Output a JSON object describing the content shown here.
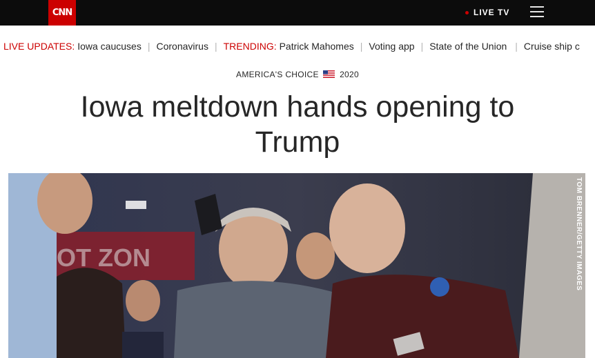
{
  "header": {
    "logo_text": "CNN",
    "live_tv": "LIVE TV",
    "menu_icon": "hamburger-menu-icon",
    "brand_color": "#cc0000"
  },
  "ticker": {
    "items": [
      {
        "prefix": "LIVE UPDATES:",
        "label": "Iowa caucuses"
      },
      {
        "prefix": "",
        "label": "Coronavirus"
      },
      {
        "prefix": "TRENDING:",
        "label": "Patrick Mahomes"
      },
      {
        "prefix": "",
        "label": "Voting app"
      },
      {
        "prefix": "",
        "label": "State of the Union"
      },
      {
        "prefix": "",
        "label": "Cruise ship c"
      }
    ]
  },
  "section": {
    "label_left": "AMERICA'S CHOICE",
    "label_right": "2020",
    "flag_icon": "us-flag-icon"
  },
  "article": {
    "headline": "Iowa meltdown hands opening to Trump",
    "photo_credit": "TOM BRENNER/GETTY IMAGES"
  }
}
